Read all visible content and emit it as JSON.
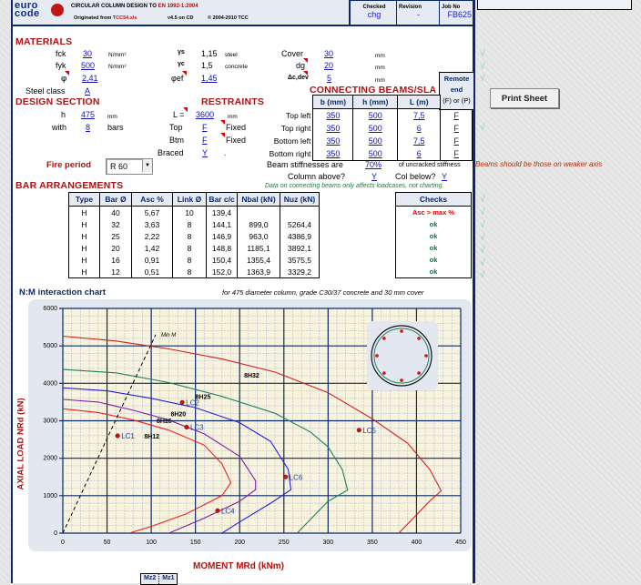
{
  "header": {
    "logo_top": "euro",
    "logo_bottom": "code",
    "title_prefix": "CIRCULAR COLUMN DESIGN TO ",
    "title_code": "EN 1992-1:2004",
    "origin_prefix": "Originated from ",
    "origin_file": "TCC54.xls",
    "version": "v4.5 on CD",
    "copyright": "© 2004-2010 TCC",
    "checked_label": "Checked",
    "checked_value": "chg",
    "revision_label": "Revision",
    "revision_value": "-",
    "jobno_label": "Job No",
    "jobno_value": "FB625"
  },
  "materials": {
    "heading": "MATERIALS",
    "fck_label": "fck",
    "fck_value": "30",
    "fck_unit": "N/mm²",
    "fyk_label": "fyk",
    "fyk_value": "500",
    "fyk_unit": "N/mm²",
    "phi_label": "φ",
    "phi_value": "2,41",
    "steel_class_label": "Steel class",
    "steel_class_value": "A",
    "gamma_s_label": "γs",
    "gamma_s_value": "1,15",
    "gamma_s_note": "steel",
    "gamma_c_label": "γc",
    "gamma_c_value": "1,5",
    "gamma_c_note": "concrete",
    "phi_ef_label": "φef",
    "phi_ef_value": "1,45",
    "cover_label": "Cover",
    "cover_value": "30",
    "cover_unit": "mm",
    "dg_label": "dg",
    "dg_value": "20",
    "dg_unit": "mm",
    "delta_label": "Δc,dev",
    "delta_value": "5",
    "delta_unit": "mm"
  },
  "design_section": {
    "heading": "DESIGN  SECTION",
    "h_label": "h",
    "h_value": "475",
    "h_unit": "mm",
    "with_label": "with",
    "bars_value": "8",
    "bars_unit": "bars"
  },
  "restraints": {
    "heading": "RESTRAINTS",
    "L_label": "L =",
    "L_value": "3600",
    "L_unit": "mm",
    "top_label": "Top",
    "top_value": "F",
    "top_note": "Fixed",
    "btm_label": "Btm",
    "btm_value": "F",
    "btm_note": "Fixed",
    "braced_label": "Braced",
    "braced_value": "Y",
    "braced_note": "."
  },
  "connecting_beams": {
    "heading": "CONNECTING BEAMS/SLA",
    "remote_end_label_1": "Remote",
    "remote_end_label_2": "end",
    "headers": [
      "b (mm)",
      "h (mm)",
      "L (m)",
      "(F) or (P)"
    ],
    "rows": [
      {
        "label": "Top left",
        "b": "350",
        "h": "500",
        "L": "7,5",
        "end": "F"
      },
      {
        "label": "Top right",
        "b": "350",
        "h": "500",
        "L": "6",
        "end": "F"
      },
      {
        "label": "Bottom left",
        "b": "350",
        "h": "500",
        "L": "7,5",
        "end": "F"
      },
      {
        "label": "Bottom right",
        "b": "350",
        "h": "500",
        "L": "6",
        "end": "F"
      }
    ],
    "stiffness_label": "Beam stiffnesses are",
    "stiffness_value": "70%",
    "stiffness_note": "of uncracked stiffness",
    "column_above_label": "Column above?",
    "column_above_value": "Y",
    "col_below_label": "Col below?",
    "col_below_value": "Y",
    "note": "Data on connecting beams only affects loadcases, not charting.",
    "warning": "Beams should be those on weaker axis"
  },
  "fire": {
    "label": "Fire period",
    "selected": "R 60"
  },
  "print_button": "Print Sheet",
  "bar_arrangements": {
    "heading": "BAR ARRANGEMENTS",
    "headers": [
      "Type",
      "Bar Ø",
      "Asc %",
      "Link Ø",
      "Bar c/c",
      "Nbal (kN)",
      "Nuz (kN)"
    ],
    "rows": [
      [
        "H",
        "40",
        "5,67",
        "10",
        "139,4",
        "",
        ""
      ],
      [
        "H",
        "32",
        "3,63",
        "8",
        "144,1",
        "899,0",
        "5264,4"
      ],
      [
        "H",
        "25",
        "2,22",
        "8",
        "146,9",
        "963,0",
        "4386,9"
      ],
      [
        "H",
        "20",
        "1,42",
        "8",
        "148,8",
        "1185,1",
        "3892,1"
      ],
      [
        "H",
        "16",
        "0,91",
        "8",
        "150,4",
        "1355,4",
        "3575,5"
      ],
      [
        "H",
        "12",
        "0,51",
        "8",
        "152,0",
        "1363,9",
        "3329,2"
      ]
    ],
    "checks_header": "Checks",
    "checks": [
      "Asc > max %",
      "ok",
      "ok",
      "ok",
      "ok",
      "ok"
    ],
    "check_colors": {
      "fail": "#e00000",
      "ok": "#107040"
    }
  },
  "tick_marks": [
    "√",
    "√",
    "√",
    "√",
    "√",
    "√",
    "√",
    "√",
    "√",
    "√",
    "√",
    "√"
  ],
  "chart_tabs": [
    "Mz2",
    "Mz1"
  ],
  "chart_data": {
    "type": "line",
    "title": "N:M interaction chart",
    "subtitle": "for 475 diameter column, grade C30/37 concrete and 30 mm cover",
    "xlabel": "MOMENT MRd (kNm)",
    "ylabel": "AXIAL LOAD NRd (kN)",
    "xlim": [
      0,
      450
    ],
    "ylim": [
      0,
      6000
    ],
    "xticks": [
      0,
      50,
      100,
      150,
      200,
      250,
      300,
      350,
      400,
      450
    ],
    "yticks": [
      0,
      1000,
      2000,
      3000,
      4000,
      5000,
      6000
    ],
    "grid": true,
    "series": [
      {
        "name": "8H32",
        "color": "#d02020",
        "points": [
          [
            0,
            5260
          ],
          [
            60,
            5130
          ],
          [
            120,
            4920
          ],
          [
            180,
            4650
          ],
          [
            240,
            4300
          ],
          [
            300,
            3750
          ],
          [
            350,
            3050
          ],
          [
            390,
            2400
          ],
          [
            415,
            1700
          ],
          [
            428,
            1130
          ],
          [
            415,
            860
          ],
          [
            380,
            0
          ]
        ],
        "label_at": [
          205,
          4150
        ]
      },
      {
        "name": "8H25",
        "color": "#208060",
        "points": [
          [
            0,
            4370
          ],
          [
            60,
            4280
          ],
          [
            120,
            4020
          ],
          [
            180,
            3650
          ],
          [
            240,
            3200
          ],
          [
            280,
            2700
          ],
          [
            300,
            2300
          ],
          [
            316,
            1700
          ],
          [
            322,
            1150
          ],
          [
            300,
            850
          ],
          [
            265,
            0
          ]
        ],
        "label_at": [
          150,
          3580
        ]
      },
      {
        "name": "8H20",
        "color": "#2020e0",
        "points": [
          [
            0,
            3880
          ],
          [
            50,
            3800
          ],
          [
            100,
            3600
          ],
          [
            150,
            3350
          ],
          [
            200,
            2950
          ],
          [
            235,
            2450
          ],
          [
            255,
            1700
          ],
          [
            258,
            1160
          ],
          [
            235,
            800
          ],
          [
            200,
            300
          ],
          [
            180,
            0
          ]
        ],
        "label_at": [
          122,
          3120
        ]
      },
      {
        "name": "8H16",
        "color": "#8020a0",
        "points": [
          [
            0,
            3570
          ],
          [
            40,
            3500
          ],
          [
            80,
            3280
          ],
          [
            120,
            3020
          ],
          [
            160,
            2650
          ],
          [
            200,
            2050
          ],
          [
            218,
            1400
          ],
          [
            218,
            1160
          ],
          [
            200,
            850
          ],
          [
            160,
            400
          ],
          [
            120,
            0
          ]
        ],
        "label_at": [
          106,
          2940
        ]
      },
      {
        "name": "8H12",
        "color": "#f02020",
        "points": [
          [
            0,
            3320
          ],
          [
            40,
            3220
          ],
          [
            80,
            3020
          ],
          [
            120,
            2750
          ],
          [
            160,
            2350
          ],
          [
            180,
            1850
          ],
          [
            190,
            1350
          ],
          [
            180,
            1000
          ],
          [
            140,
            520
          ],
          [
            100,
            180
          ],
          [
            75,
            0
          ]
        ],
        "label_at": [
          92,
          2530
        ]
      }
    ],
    "min_m_line": {
      "label": "Min M",
      "points": [
        [
          0,
          0
        ],
        [
          105,
          5300
        ]
      ],
      "color": "#000000"
    },
    "load_cases": [
      {
        "name": "LC1",
        "M": 62,
        "N": 2600
      },
      {
        "name": "LC2",
        "M": 135,
        "N": 3490
      },
      {
        "name": "LC3",
        "M": 140,
        "N": 2830
      },
      {
        "name": "LC4",
        "M": 175,
        "N": 600
      },
      {
        "name": "LC5",
        "M": 335,
        "N": 2750
      },
      {
        "name": "LC6",
        "M": 252,
        "N": 1500
      }
    ],
    "section_inset": {
      "bars": 8
    }
  }
}
